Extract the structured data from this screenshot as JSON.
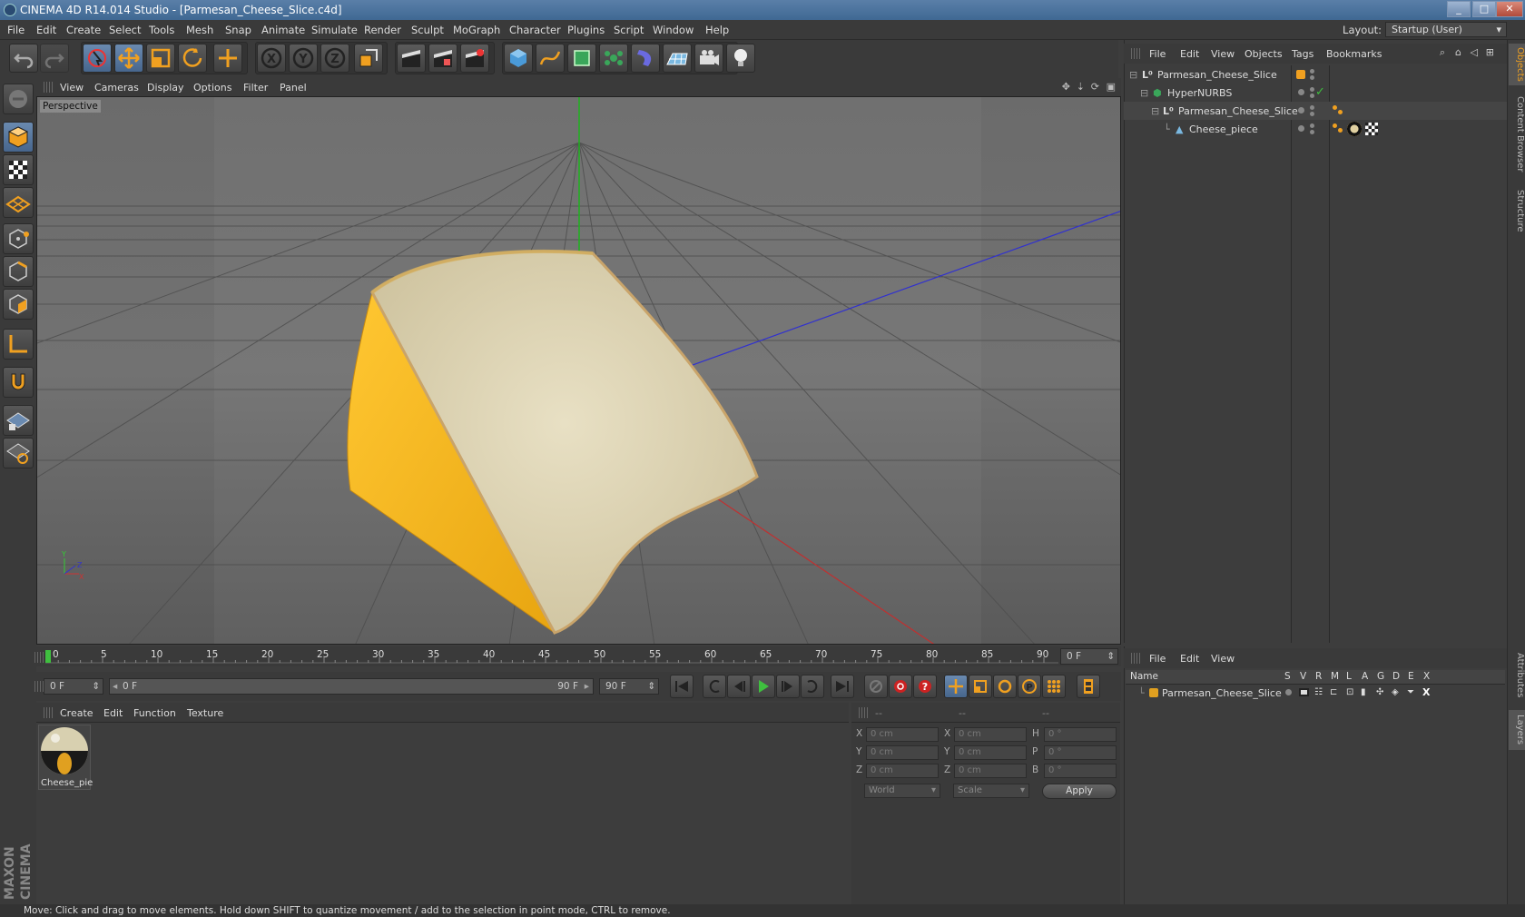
{
  "window": {
    "title": "CINEMA 4D R14.014 Studio - [Parmesan_Cheese_Slice.c4d]",
    "min_icon": "minimize-icon",
    "max_icon": "maximize-icon",
    "close_icon": "close-icon"
  },
  "menubar": {
    "items": [
      "File",
      "Edit",
      "Create",
      "Select",
      "Tools",
      "Mesh",
      "Snap",
      "Animate",
      "Simulate",
      "Render",
      "Sculpt",
      "MoGraph",
      "Character",
      "Plugins",
      "Script",
      "Window",
      "Help"
    ],
    "layout_label": "Layout:",
    "layout_value": "Startup (User)"
  },
  "viewport": {
    "menu": [
      "View",
      "Cameras",
      "Display",
      "Options",
      "Filter",
      "Panel"
    ],
    "label": "Perspective"
  },
  "timeline": {
    "ticks": [
      "0",
      "5",
      "10",
      "15",
      "20",
      "25",
      "30",
      "35",
      "40",
      "45",
      "50",
      "55",
      "60",
      "65",
      "70",
      "75",
      "80",
      "85",
      "90"
    ],
    "current_frame": "0 F"
  },
  "transport": {
    "start_field": "0 F",
    "range_start": "0 F",
    "range_end": "90 F",
    "end_field": "90 F"
  },
  "materials": {
    "menu": [
      "Create",
      "Edit",
      "Function",
      "Texture"
    ],
    "items": [
      {
        "name": "Cheese_pie"
      }
    ]
  },
  "coords": {
    "headers": [
      "--",
      "--",
      "--"
    ],
    "rows": [
      {
        "a": "X",
        "a_val": "0 cm",
        "b": "X",
        "b_val": "0 cm",
        "c": "H",
        "c_val": "0 °"
      },
      {
        "a": "Y",
        "a_val": "0 cm",
        "b": "Y",
        "b_val": "0 cm",
        "c": "P",
        "c_val": "0 °"
      },
      {
        "a": "Z",
        "a_val": "0 cm",
        "b": "Z",
        "b_val": "0 cm",
        "c": "B",
        "c_val": "0 °"
      }
    ],
    "space": "World",
    "mode": "Scale",
    "apply": "Apply"
  },
  "objects": {
    "menu": [
      "File",
      "Edit",
      "View",
      "Objects",
      "Tags",
      "Bookmarks"
    ],
    "tree": [
      {
        "name": "Parmesan_Cheese_Slice",
        "icon": "null-object-icon"
      },
      {
        "name": "HyperNURBS",
        "icon": "hypernurbs-icon"
      },
      {
        "name": "Parmesan_Cheese_Slice",
        "icon": "null-object-icon"
      },
      {
        "name": "Cheese_piece",
        "icon": "polygon-object-icon"
      }
    ]
  },
  "layers": {
    "menu": [
      "File",
      "Edit",
      "View"
    ],
    "columns": [
      "Name",
      "S",
      "V",
      "R",
      "M",
      "L",
      "A",
      "G",
      "D",
      "E",
      "X"
    ],
    "rows": [
      {
        "name": "Parmesan_Cheese_Slice",
        "color": "#e0a020"
      }
    ]
  },
  "sidetabs": [
    "Objects",
    "Content Browser",
    "Structure",
    "Attributes",
    "Layers"
  ],
  "status": "Move: Click and drag to move elements. Hold down SHIFT to quantize movement / add to the selection in point mode, CTRL to remove.",
  "colors": {
    "accent": "#f0a020",
    "selection": "#5a7fa8"
  }
}
